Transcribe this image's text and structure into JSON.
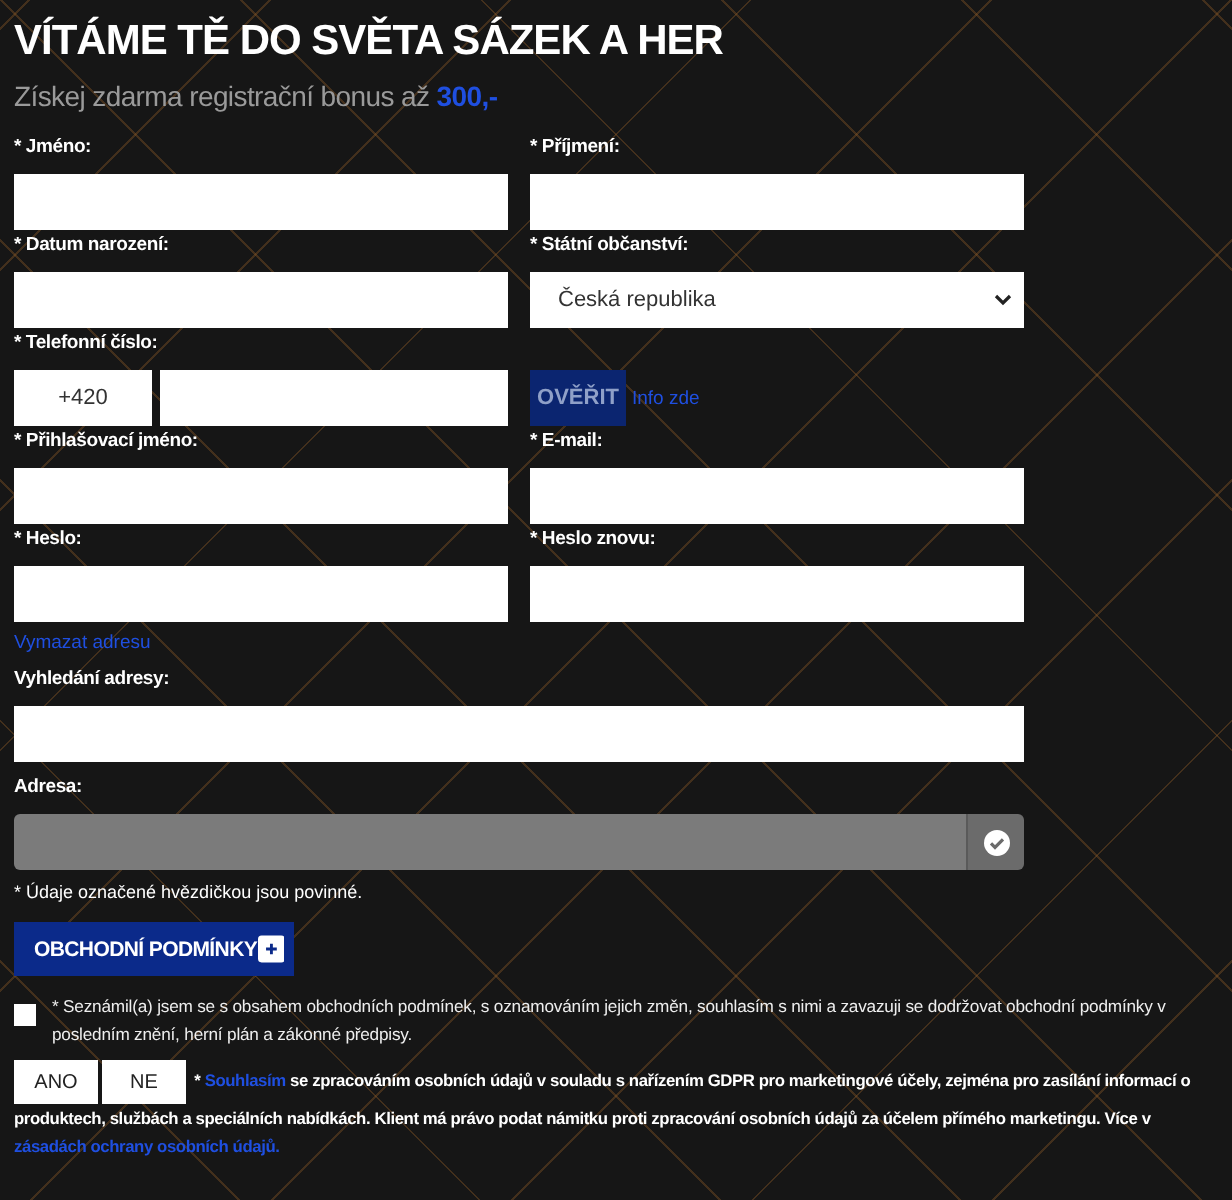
{
  "title": "VÍTÁME TĚ DO SVĚTA SÁZEK A HER",
  "subtitle": {
    "text": "Získej zdarma registrační bonus až",
    "amount": "300,-"
  },
  "fields": [
    {
      "kind": "text",
      "label": "* Jméno:"
    },
    {
      "kind": "text",
      "label": "* Příjmení:"
    },
    {
      "kind": "text",
      "label": "* Datum narození:"
    },
    {
      "kind": "select",
      "label": "* Státní občanství:",
      "value": "Česká republika"
    },
    {
      "kind": "phone",
      "label": "* Telefonní číslo:",
      "prefix": "+420",
      "button": "OVĚŘIT",
      "link": "Info zde"
    },
    {
      "kind": "text",
      "label": "* Přihlašovací jméno:"
    },
    {
      "kind": "text",
      "label": "* E-mail:"
    },
    {
      "kind": "text",
      "label": "* Heslo:"
    },
    {
      "kind": "text",
      "label": "* Heslo znovu:"
    }
  ],
  "clear_address_link": "Vymazat adresu",
  "address_search": {
    "label": "Vyhledání adresy:"
  },
  "address": {
    "label": "Adresa:",
    "disabled": true
  },
  "required_note": "* Údaje označené hvězdičkou jsou povinné.",
  "terms_button": {
    "label": "OBCHODNÍ PODMÍNKY",
    "expanded": false
  },
  "consent": {
    "checked": false,
    "text": "* Seznámil(a) jsem se s obsahem obchodních podmínek, s oznamováním jejich změn, souhlasím s nimi a zavazuji se dodržovat obchodní podmínky v posledním znění, herní plán a zákonné předpisy."
  },
  "marketing": {
    "options": [
      {
        "label": "ANO",
        "selected": false
      },
      {
        "label": "NE",
        "selected": false
      }
    ],
    "prefix": "*",
    "link": "Souhlasím",
    "text": "se zpracováním osobních údajů v souladu s nařízením GDPR pro marketingové účely, zejména pro zasílání informací o produktech, službách a speciálních nabídkách. Klient má právo podat námitku proti zpracování osobních údajů za účelem přímého marketingu. Více v",
    "link2": "zásadách ochrany osobních údajů."
  }
}
